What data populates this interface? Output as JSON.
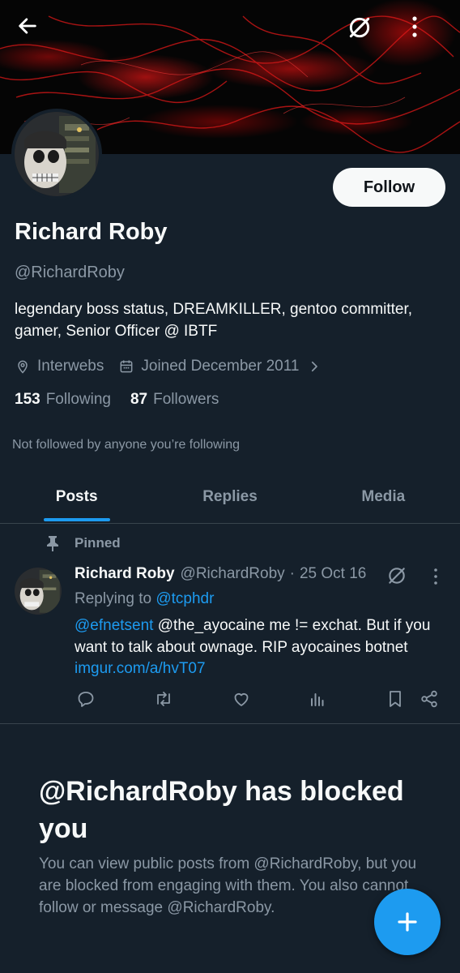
{
  "header": {
    "back_icon": "arrow-left-icon",
    "grok_icon": "slashed-circle-icon",
    "more_icon": "vertical-dots-icon"
  },
  "profile": {
    "follow_label": "Follow",
    "name": "Richard Roby",
    "handle": "@RichardRoby",
    "bio": "legendary boss status, DREAMKILLER, gentoo committer, gamer, Senior Officer @ IBTF",
    "location": "Interwebs",
    "joined": "Joined December 2011",
    "following_count": "153",
    "following_label": "Following",
    "followers_count": "87",
    "followers_label": "Followers",
    "not_followed": "Not followed by anyone you’re following"
  },
  "tabs": [
    {
      "label": "Posts",
      "active": true
    },
    {
      "label": "Replies",
      "active": false
    },
    {
      "label": "Media",
      "active": false
    }
  ],
  "post": {
    "pinned_label": "Pinned",
    "author_name": "Richard Roby",
    "author_handle": "@RichardRoby",
    "dot": "·",
    "date": "25 Oct 16",
    "replying_prefix": "Replying to",
    "replying_to": "@tcphdr",
    "mention": "@efnetsent",
    "body_text": "@the_ayocaine me != exchat. But if you want to talk about ownage. RIP ayocaines botnet",
    "link_text": "imgur.com/a/hvT07",
    "action_icons": [
      "reply-icon",
      "repost-icon",
      "like-icon",
      "views-icon",
      "bookmark-icon",
      "share-icon"
    ]
  },
  "blocked": {
    "title": "@RichardRoby has blocked you",
    "text": "You can view public posts from @RichardRoby, but you are blocked from engaging with them. You also cannot follow or message @RichardRoby."
  },
  "colors": {
    "background": "#15202b",
    "accent": "#1d9bf0",
    "muted": "#8b98a5",
    "text": "#f7f9f9"
  }
}
